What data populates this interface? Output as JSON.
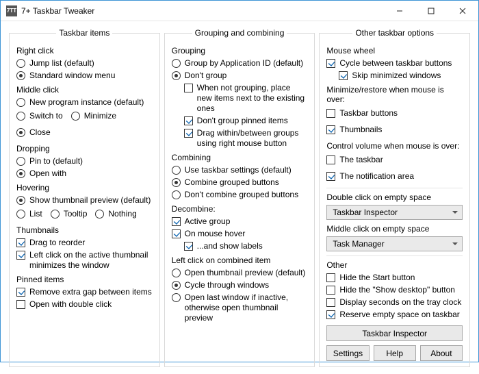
{
  "window": {
    "title": "7+ Taskbar Tweaker",
    "icon_text": "7TT"
  },
  "columns": {
    "left": {
      "legend": "Taskbar items",
      "right_click": {
        "label": "Right click",
        "jump_list": "Jump list (default)",
        "standard_menu": "Standard window menu"
      },
      "middle_click": {
        "label": "Middle click",
        "new_instance": "New program instance (default)",
        "switch_to": "Switch to",
        "minimize": "Minimize",
        "close": "Close"
      },
      "dropping": {
        "label": "Dropping",
        "pin_to": "Pin to (default)",
        "open_with": "Open with"
      },
      "hovering": {
        "label": "Hovering",
        "thumb_preview": "Show thumbnail preview (default)",
        "list": "List",
        "tooltip": "Tooltip",
        "nothing": "Nothing"
      },
      "thumbnails": {
        "label": "Thumbnails",
        "drag_reorder": "Drag to reorder",
        "left_click_min": "Left click on the active thumbnail minimizes the window"
      },
      "pinned": {
        "label": "Pinned items",
        "remove_gap": "Remove extra gap between items",
        "open_double": "Open with double click"
      }
    },
    "mid": {
      "legend": "Grouping and combining",
      "grouping": {
        "label": "Grouping",
        "by_appid": "Group by Application ID (default)",
        "dont_group": "Don't group",
        "place_next": "When not grouping, place new items next to the existing ones",
        "dont_group_pinned": "Don't group pinned items",
        "drag_between": "Drag within/between groups using right mouse button"
      },
      "combining": {
        "label": "Combining",
        "use_taskbar": "Use taskbar settings (default)",
        "combine_grouped": "Combine grouped buttons",
        "dont_combine": "Don't combine grouped buttons"
      },
      "decombine": {
        "label": "Decombine:",
        "active_group": "Active group",
        "on_hover": "On mouse hover",
        "show_labels": "...and show labels"
      },
      "left_click": {
        "label": "Left click on combined item",
        "open_thumb": "Open thumbnail preview (default)",
        "cycle": "Cycle through windows",
        "open_last": "Open last window if inactive, otherwise open thumbnail preview"
      }
    },
    "right": {
      "legend": "Other taskbar options",
      "mouse_wheel": {
        "label": "Mouse wheel",
        "cycle": "Cycle between taskbar buttons",
        "skip_min": "Skip minimized windows"
      },
      "minimize_restore": {
        "label": "Minimize/restore when mouse is over:",
        "taskbar_buttons": "Taskbar buttons",
        "thumbnails": "Thumbnails"
      },
      "control_volume": {
        "label": "Control volume when mouse is over:",
        "the_taskbar": "The taskbar",
        "notification_area": "The notification area"
      },
      "double_click": {
        "label": "Double click on empty space",
        "value": "Taskbar Inspector"
      },
      "middle_click": {
        "label": "Middle click on empty space",
        "value": "Task Manager"
      },
      "other": {
        "label": "Other",
        "hide_start": "Hide the Start button",
        "hide_desktop": "Hide the \"Show desktop\" button",
        "tray_seconds": "Display seconds on the tray clock",
        "reserve_space": "Reserve empty space on taskbar"
      },
      "buttons": {
        "inspector": "Taskbar Inspector",
        "settings": "Settings",
        "help": "Help",
        "about": "About"
      }
    }
  }
}
